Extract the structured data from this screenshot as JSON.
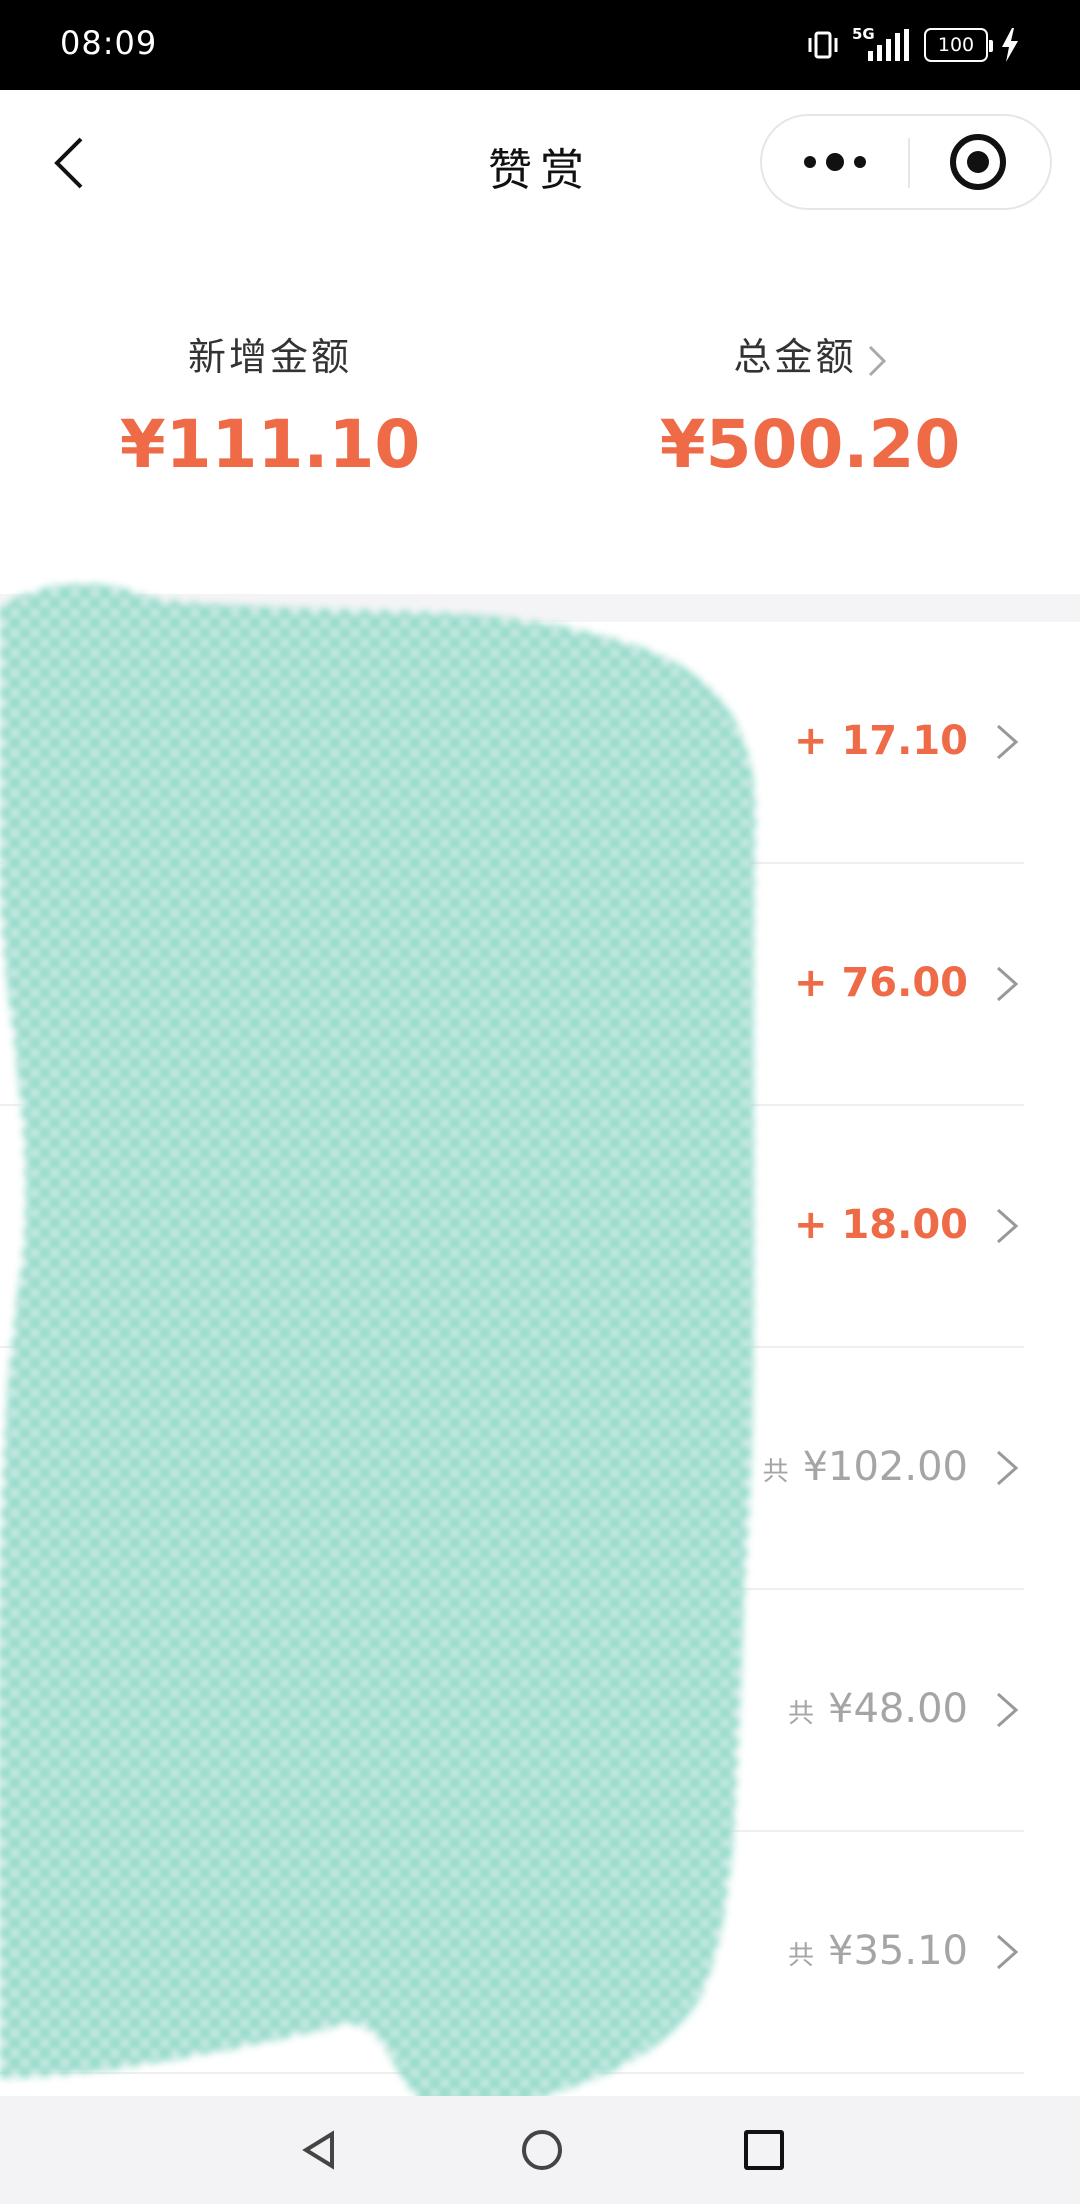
{
  "status_bar": {
    "time": "08:09",
    "network": "5G",
    "battery": "100"
  },
  "header": {
    "title": "赞赏",
    "back_icon": "chevron-left-icon",
    "more_icon": "more-dots-icon",
    "close_icon": "target-circle-icon"
  },
  "summary": {
    "new_amount_label": "新增金额",
    "new_amount_value": "¥111.10",
    "total_amount_label": "总金额",
    "total_amount_value": "¥500.20"
  },
  "rows": [
    {
      "amount": "+ 17.10",
      "type": "positive"
    },
    {
      "amount": "+ 76.00",
      "type": "positive"
    },
    {
      "amount": "+ 18.00",
      "type": "positive"
    },
    {
      "prefix": "共",
      "amount": "¥102.00",
      "type": "total"
    },
    {
      "prefix": "共",
      "amount": "¥48.00",
      "type": "total"
    },
    {
      "prefix": "共",
      "amount": "¥35.10",
      "type": "total"
    }
  ],
  "colors": {
    "accent": "#ef6a47",
    "muted": "#a5a5a5",
    "redaction": "#8fd9c9"
  }
}
